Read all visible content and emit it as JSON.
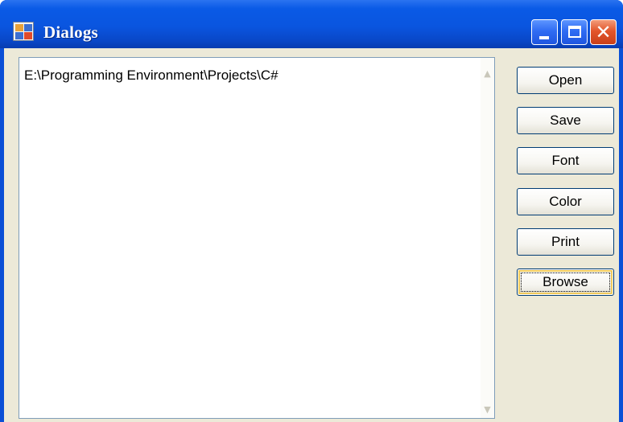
{
  "window": {
    "title": "Dialogs",
    "controls": {
      "minimize": "minimize-icon",
      "maximize": "maximize-icon",
      "close": "close-icon",
      "close_glyph": "✕"
    }
  },
  "textbox": {
    "value": "E:\\Programming Environment\\Projects\\C#",
    "scroll_up_glyph": "▲",
    "scroll_down_glyph": "▼"
  },
  "buttons": [
    {
      "label": "Open"
    },
    {
      "label": "Save"
    },
    {
      "label": "Font"
    },
    {
      "label": "Color"
    },
    {
      "label": "Print"
    },
    {
      "label": "Browse",
      "focused": true
    }
  ],
  "colors": {
    "titlebar": "#0a55df",
    "client_background": "#ece9d8",
    "button_border": "#003c74",
    "close_button": "#e3562b"
  }
}
